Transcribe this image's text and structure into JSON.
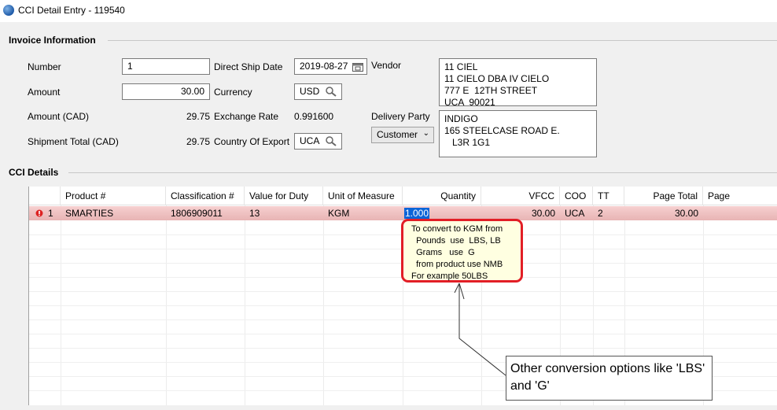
{
  "window": {
    "title": "CCI Detail Entry - 119540"
  },
  "invoice": {
    "section_label": "Invoice Information",
    "number_label": "Number",
    "number_value": "1",
    "amount_label": "Amount",
    "amount_value": "30.00",
    "amount_cad_label": "Amount (CAD)",
    "amount_cad_value": "29.75",
    "shipment_total_label": "Shipment Total (CAD)",
    "shipment_total_value": "29.75",
    "direct_ship_date_label": "Direct Ship Date",
    "direct_ship_date_value": "2019-08-27",
    "currency_label": "Currency",
    "currency_value": "USD",
    "exchange_rate_label": "Exchange Rate",
    "exchange_rate_value": "0.991600",
    "country_of_export_label": "Country Of Export",
    "country_of_export_value": "UCA",
    "vendor_label": "Vendor",
    "vendor_value": "11 CIEL\n11 CIELO DBA IV CIELO\n777 E  12TH STREET\nUCA  90021",
    "delivery_party_label": "Delivery Party",
    "delivery_party_select": "Customer",
    "delivery_party_value": "INDIGO\n165 STEELCASE ROAD E.\n   L3R 1G1"
  },
  "cci": {
    "section_label": "CCI Details",
    "columns": {
      "product": "Product #",
      "classification": "Classification #",
      "value_for_duty": "Value for Duty",
      "unit_of_measure": "Unit of Measure",
      "quantity": "Quantity",
      "vfcc": "VFCC",
      "coo": "COO",
      "tt": "TT",
      "page_total": "Page Total",
      "page": "Page"
    },
    "row": {
      "line": "1",
      "product": "SMARTIES",
      "classification": "1806909011",
      "value_for_duty": "13",
      "unit_of_measure": "KGM",
      "quantity": "1.000",
      "vfcc": "30.00",
      "coo": "UCA",
      "tt": "2",
      "page_total": "30.00"
    }
  },
  "tooltip": {
    "lines": [
      "To convert to KGM from",
      "  Pounds  use  LBS, LB",
      "  Grams   use  G",
      "  from product use NMB",
      "For example 50LBS"
    ]
  },
  "callout": {
    "text": "Other conversion options like 'LBS' and 'G'"
  },
  "colors": {
    "accent_red": "#e21e26",
    "row_error": "#e8b4b4",
    "tooltip_bg": "#ffffe1"
  }
}
